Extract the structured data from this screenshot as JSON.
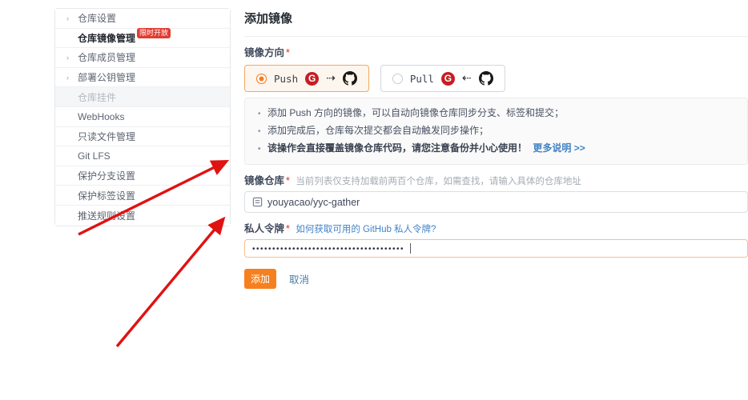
{
  "colors": {
    "accent_orange": "#f67b21",
    "gitee_red": "#c71d23",
    "link_blue": "#4183c4",
    "badge_red": "#e23c32",
    "annotation_arrow_red": "#e01212"
  },
  "sidebar": {
    "items": [
      {
        "label": "仓库设置",
        "chevron": true
      },
      {
        "label": "仓库镜像管理",
        "active": true,
        "badge": "限时开放"
      },
      {
        "label": "仓库成员管理",
        "chevron": true
      },
      {
        "label": "部署公钥管理",
        "chevron": true
      },
      {
        "label": "仓库挂件",
        "disabled": true
      },
      {
        "label": "WebHooks"
      },
      {
        "label": "只读文件管理"
      },
      {
        "label": "Git LFS"
      },
      {
        "label": "保护分支设置"
      },
      {
        "label": "保护标签设置"
      },
      {
        "label": "推送规则设置"
      }
    ],
    "chevron_glyph": "›"
  },
  "main": {
    "title": "添加镜像",
    "direction": {
      "label": "镜像方向",
      "required": "*",
      "options": [
        {
          "name": "Push",
          "selected": true,
          "arrow": "⇢"
        },
        {
          "name": "Pull",
          "selected": false,
          "arrow": "⇠"
        }
      ],
      "gitee_letter": "G"
    },
    "notice": {
      "items": [
        "添加 Push 方向的镜像，可以自动向镜像仓库同步分支、标签和提交；",
        "添加完成后，仓库每次提交都会自动触发同步操作；"
      ],
      "bold_text": "该操作会直接覆盖镜像仓库代码，请您注意备份并小心使用！",
      "more_link": "更多说明 >>"
    },
    "mirror_repo": {
      "label": "镜像仓库",
      "required": "*",
      "hint": "当前列表仅支持加载前两百个仓库，如需查找，请输入具体的仓库地址",
      "value": "youyacao/yyc-gather"
    },
    "token": {
      "label": "私人令牌",
      "required": "*",
      "help_link": "如何获取可用的 GitHub 私人令牌?",
      "masked_value": "••••••••••••••••••••••••••••••••••••••"
    },
    "buttons": {
      "submit": "添加",
      "cancel": "取消"
    }
  }
}
